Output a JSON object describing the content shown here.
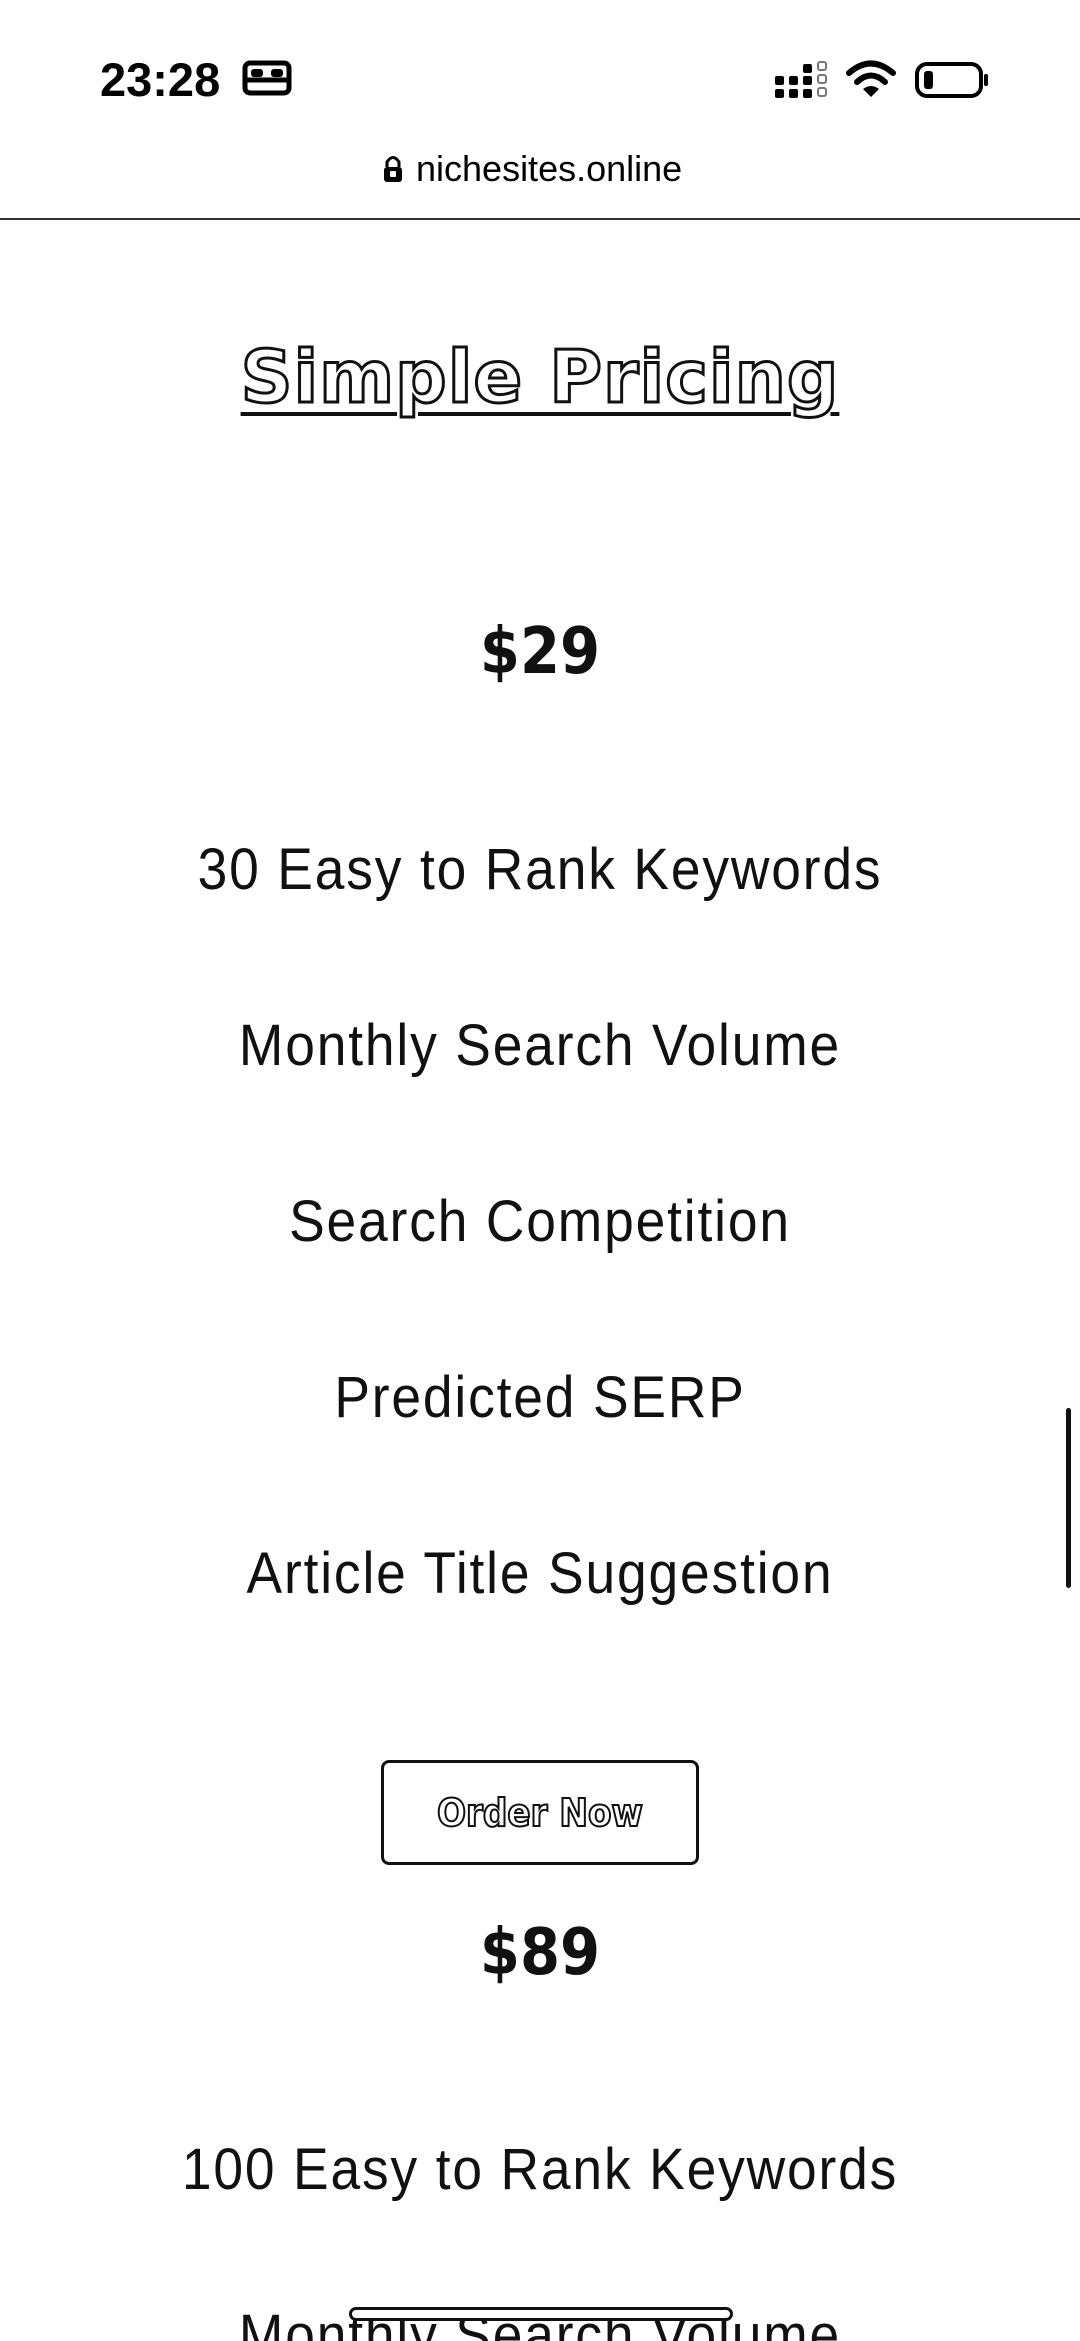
{
  "status_bar": {
    "time": "23:28",
    "icons": [
      "bed-icon",
      "signal-icon",
      "wifi-icon",
      "battery-icon"
    ]
  },
  "browser": {
    "url": "nichesites.online",
    "icon": "lock-icon"
  },
  "page": {
    "title": "Simple Pricing",
    "plans": [
      {
        "price": "$29",
        "features": [
          "30 Easy to Rank Keywords",
          "Monthly Search Volume",
          "Search Competition",
          "Predicted SERP",
          "Article Title Suggestion"
        ],
        "button_label": "Order Now"
      },
      {
        "price": "$89",
        "features": [
          "100 Easy to Rank Keywords",
          "Monthly Search Volume"
        ]
      }
    ]
  },
  "colors": {
    "text": "#111111",
    "background": "#ffffff"
  }
}
